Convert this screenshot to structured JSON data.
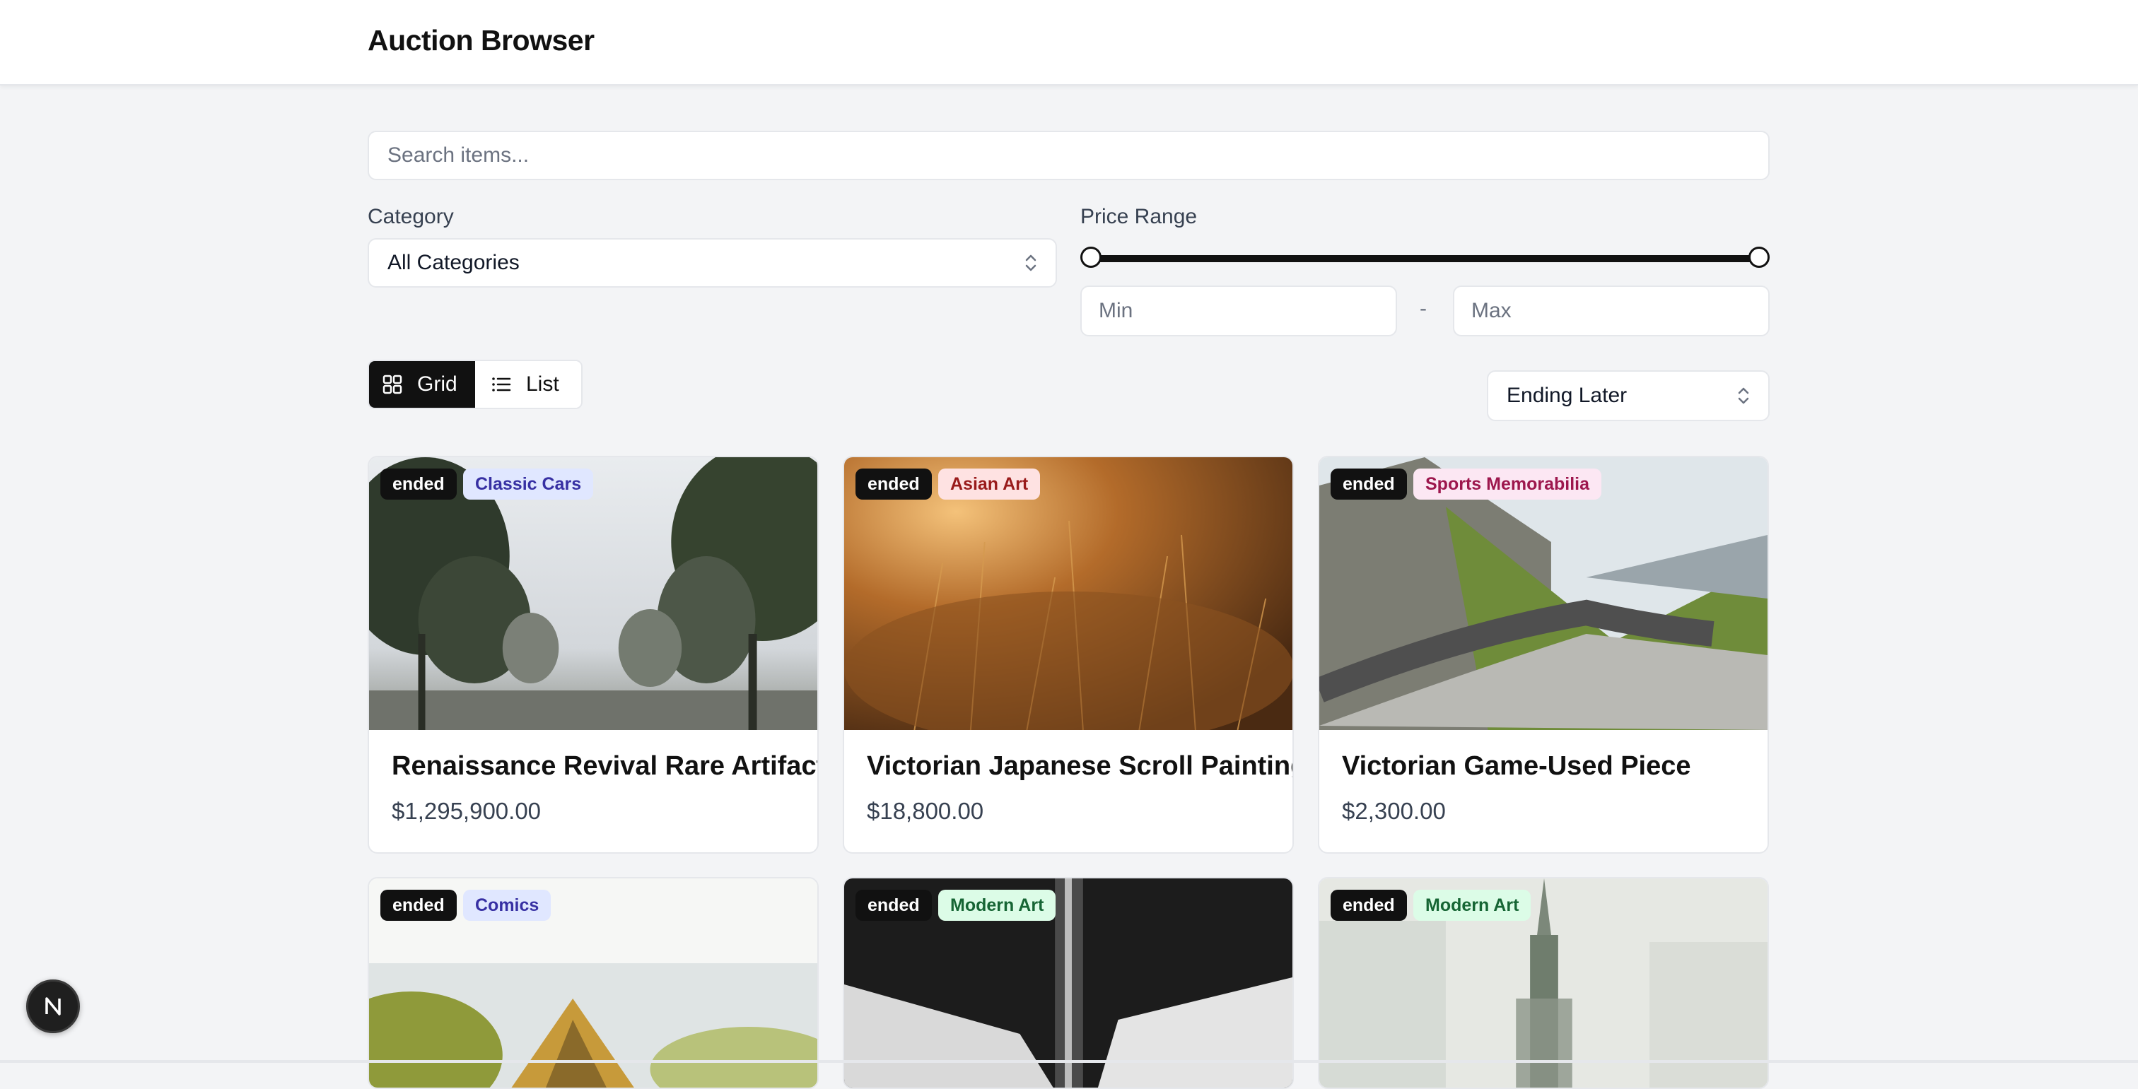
{
  "header": {
    "title": "Auction Browser"
  },
  "search": {
    "placeholder": "Search items..."
  },
  "filters": {
    "category_label": "Category",
    "category_value": "All Categories",
    "price_label": "Price Range",
    "min_placeholder": "Min",
    "max_placeholder": "Max",
    "range_separator": "-"
  },
  "view": {
    "grid_label": "Grid",
    "list_label": "List",
    "active": "Grid"
  },
  "sort": {
    "value": "Ending Later"
  },
  "cards": [
    {
      "status": "ended",
      "category": "Classic Cars",
      "title": "Renaissance Revival Rare Artifact",
      "price": "$1,295,900.00"
    },
    {
      "status": "ended",
      "category": "Asian Art",
      "title": "Victorian Japanese Scroll Painting",
      "price": "$18,800.00"
    },
    {
      "status": "ended",
      "category": "Sports Memorabilia",
      "title": "Victorian Game-Used Piece",
      "price": "$2,300.00"
    },
    {
      "status": "ended",
      "category": "Comics",
      "title": "",
      "price": ""
    },
    {
      "status": "ended",
      "category": "Modern Art",
      "title": "",
      "price": ""
    },
    {
      "status": "ended",
      "category": "Modern Art",
      "title": "",
      "price": ""
    }
  ],
  "colors": {
    "classic_cars_bg": "#e0e7ff",
    "classic_cars_fg": "#3730a3",
    "asian_art_bg": "#fee2e2",
    "asian_art_fg": "#991b1b",
    "sports_bg": "#fce7f3",
    "sports_fg": "#9d174d",
    "comics_bg": "#e0e7ff",
    "comics_fg": "#3730a3",
    "modern_art_bg": "#dcfce7",
    "modern_art_fg": "#166534"
  }
}
